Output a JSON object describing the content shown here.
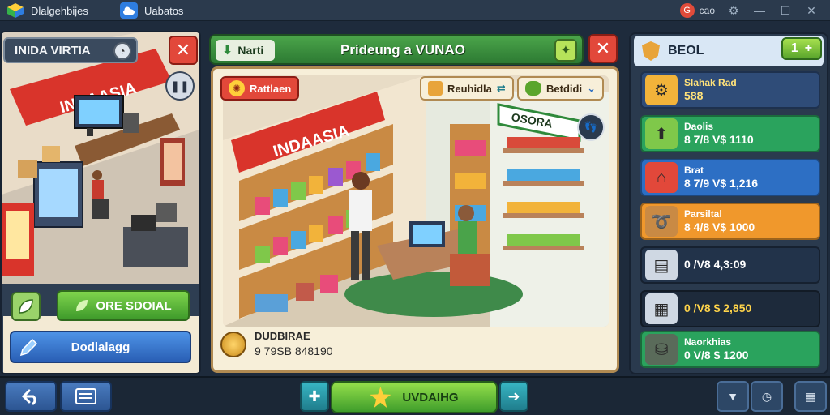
{
  "titlebar": {
    "app1_label": "Dlalgehbijes",
    "app2_label": "Uabatos",
    "user_label": "cao"
  },
  "left_panel": {
    "title": "INIDA VIRTIA",
    "sign_text": "INNAASIA",
    "primary_button": "ORE SDOIAL",
    "secondary_button": "Dodlalagg"
  },
  "center": {
    "tab_label": "Narti",
    "title": "Prideung a VUNAO",
    "badge_label": "Rattlaen",
    "filter1_label": "Reuhidla",
    "filter2_label": "Betdidi",
    "store_sign": "INDAASIA",
    "shelf_sign": "OSORA",
    "stat_label": "DUDBIRAE",
    "stat_value": "9 79SB 848190"
  },
  "right_panel": {
    "title": "BEOL",
    "add_label": "1",
    "resources": [
      {
        "name": "Slahak Rad",
        "value": "588",
        "icon": "gear-icon",
        "color": "#2f4c78",
        "text": "#ffe27a"
      },
      {
        "name": "Daolis",
        "value": "8 7/8 V$ 1110",
        "icon": "arrow-up-icon",
        "color": "#2aa35d",
        "text": "#ffffff"
      },
      {
        "name": "Brat",
        "value": "8 7/9 V$ 1,216",
        "icon": "house-icon",
        "color": "#2d6fc4",
        "text": "#ffffff"
      },
      {
        "name": "Parsiltal",
        "value": "8 4/8 V$ 1000",
        "icon": "rope-icon",
        "color": "#f0982c",
        "text": "#ffffff"
      },
      {
        "name": "",
        "value": "0 /V8 4,3:09",
        "icon": "box-icon",
        "color": "#22334a",
        "text": "#ffffff"
      },
      {
        "name": "",
        "value": "0 /V8 $ 2,850",
        "icon": "crate-icon",
        "color": "#1d2a3b",
        "text": "#ffd44a"
      },
      {
        "name": "Naorkhias",
        "value": "0 V/8 $ 1200",
        "icon": "barrel-icon",
        "color": "#2aa35d",
        "text": "#ffffff"
      }
    ]
  },
  "bottombar": {
    "main_action": "UVDAIHG"
  },
  "colors": {
    "accent_green": "#3f9d2b",
    "close_red": "#e2483a",
    "panel_bg": "#2a3a4e"
  }
}
